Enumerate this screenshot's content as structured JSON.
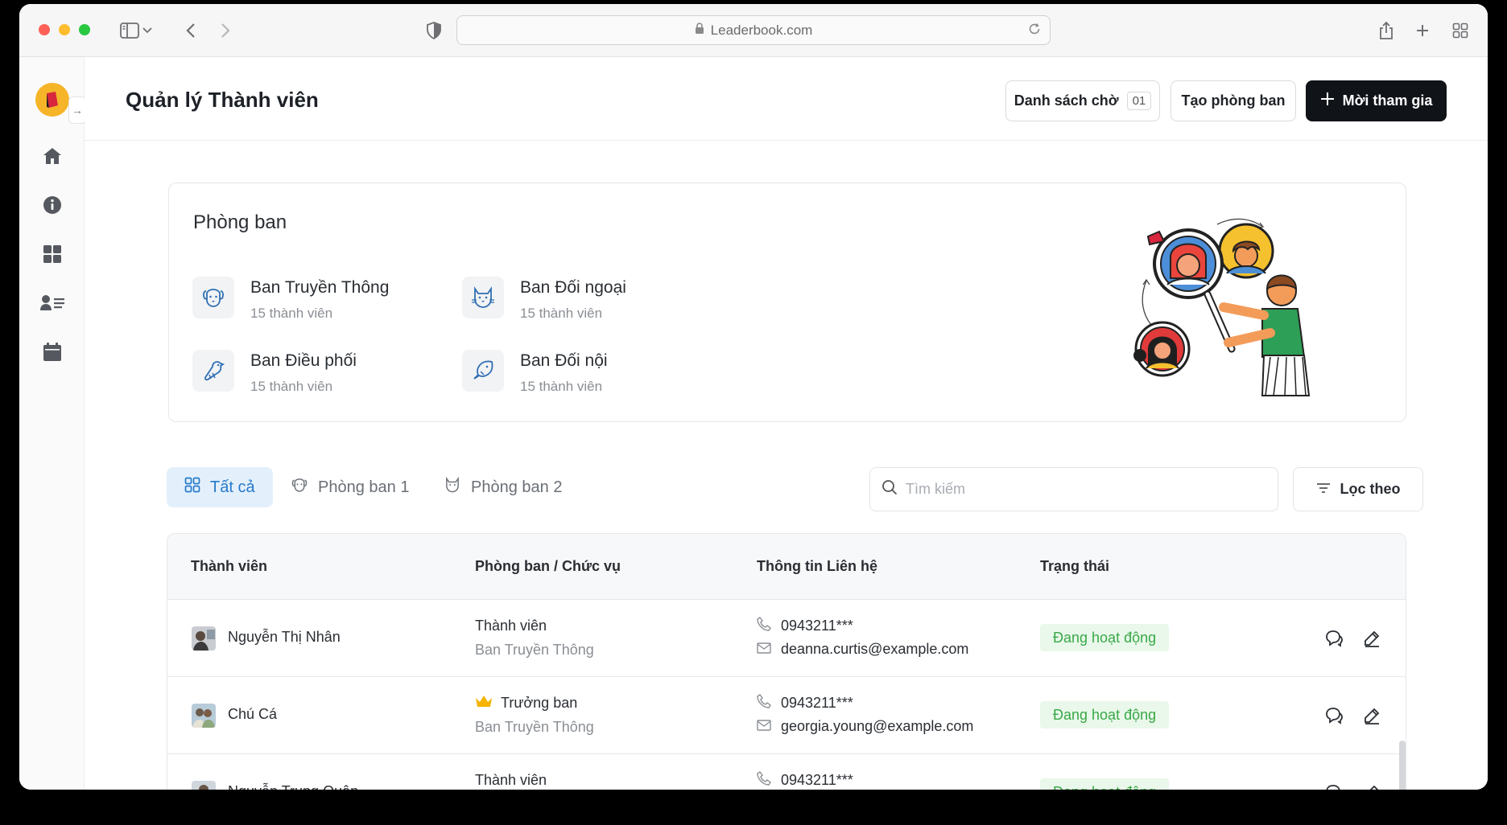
{
  "browser": {
    "url": "Leaderbook.com"
  },
  "header": {
    "title": "Quản lý Thành viên",
    "waitlist_label": "Danh sách chờ",
    "waitlist_count": "01",
    "create_dept_label": "Tạo phòng ban",
    "invite_label": "Mời tham gia"
  },
  "departments": {
    "title": "Phòng ban",
    "items": [
      {
        "name": "Ban Truyền Thông",
        "count": "15 thành viên",
        "icon": "dog-icon"
      },
      {
        "name": "Ban Đối ngoại",
        "count": "15 thành viên",
        "icon": "cat-icon"
      },
      {
        "name": "Ban Điều phối",
        "count": "15 thành viên",
        "icon": "bird-icon"
      },
      {
        "name": "Ban Đối nội",
        "count": "15 thành viên",
        "icon": "fish-icon"
      }
    ]
  },
  "tabs": [
    {
      "label": "Tất cả",
      "icon": "grid-icon",
      "active": true
    },
    {
      "label": "Phòng ban 1",
      "icon": "dog-icon"
    },
    {
      "label": "Phòng ban 2",
      "icon": "cat-icon"
    }
  ],
  "search": {
    "placeholder": "Tìm kiếm"
  },
  "filter_label": "Lọc theo",
  "table": {
    "columns": [
      "Thành viên",
      "Phòng ban / Chức vụ",
      "Thông tin Liên hệ",
      "Trạng thái"
    ],
    "rows": [
      {
        "name": "Nguyễn Thị Nhân",
        "role": "Thành viên",
        "dept": "Ban Truyền Thông",
        "phone": "0943211***",
        "email": "deanna.curtis@example.com",
        "status": "Đang hoạt động"
      },
      {
        "name": "Chú Cá",
        "role": "Trưởng ban",
        "role_icon": "crown-icon",
        "dept": "Ban Truyền Thông",
        "phone": "0943211***",
        "email": "georgia.young@example.com",
        "status": "Đang hoạt động"
      },
      {
        "name": "Nguyễn Trung Quân",
        "role": "Thành viên",
        "dept": "",
        "phone": "0943211***",
        "email": "",
        "status": "Đang hoạt động"
      }
    ]
  },
  "colors": {
    "accent": "#2679c9",
    "status_bg": "#e9f8ea",
    "status_text": "#3aa848",
    "primary_button": "#101318"
  }
}
